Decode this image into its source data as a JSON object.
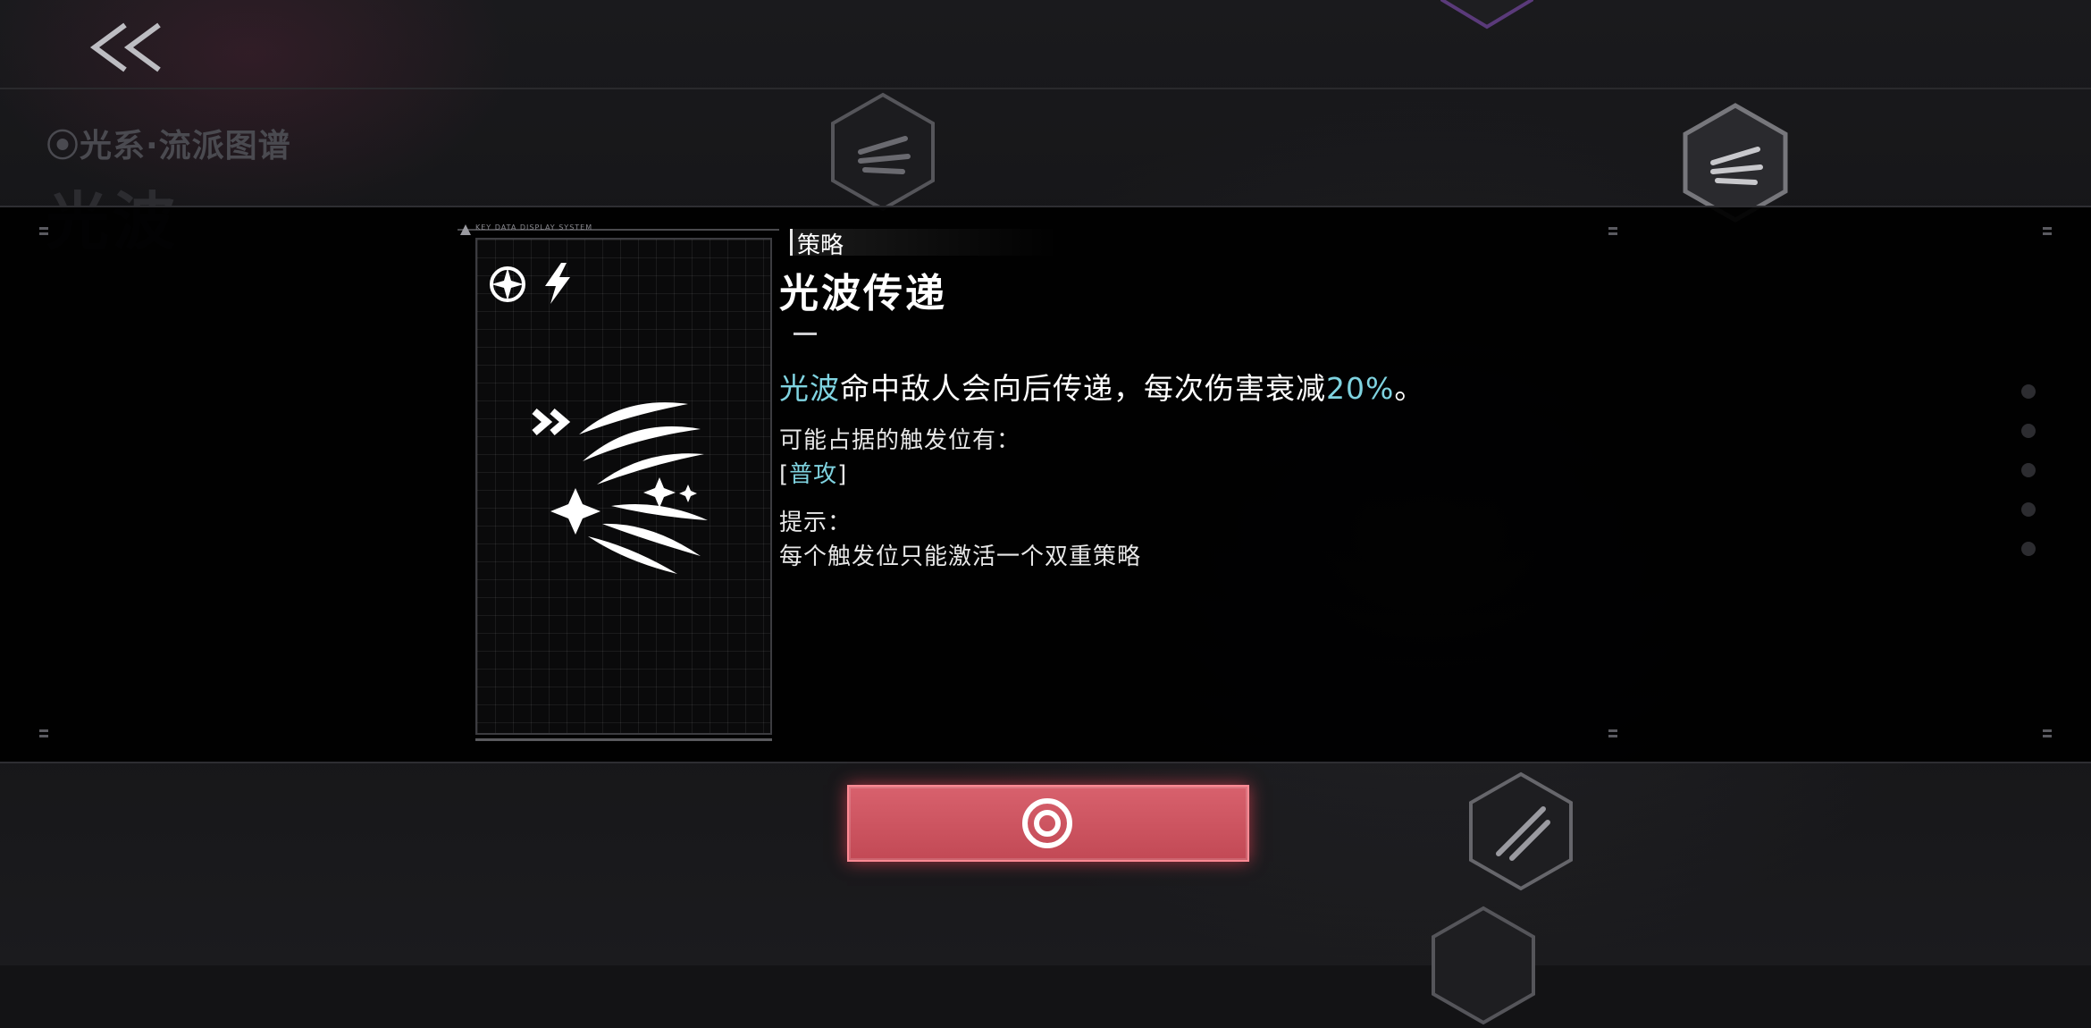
{
  "top_bar": {
    "back_icon": "double-chevron-left-icon"
  },
  "background": {
    "subtitle": "⦿光系·流派图谱",
    "big_title": "光波"
  },
  "card": {
    "header": "KEY DATA DISPLAY SYSTEM",
    "element_icon": "light-element-icon",
    "type_icon": "lightning-icon",
    "art_icon": "light-wave-claw-icon"
  },
  "detail": {
    "tag": "策略",
    "title": "光波传递",
    "desc_highlight": "光波",
    "desc_main": "命中敌人会向后传递，每次伤害衰减",
    "desc_value": "20%",
    "desc_end": "。",
    "trigger_label": "可能占据的触发位有：",
    "trigger_open": "[",
    "trigger_value": "普攻",
    "trigger_close": "]",
    "hint_label": "提示：",
    "hint_text": "每个触发位只能激活一个双重策略"
  },
  "confirm_button": {
    "icon": "target-ring-icon"
  },
  "colors": {
    "accent_cyan": "#7fd3e0",
    "button_red": "#d15a66",
    "panel_bg": "#000000"
  }
}
